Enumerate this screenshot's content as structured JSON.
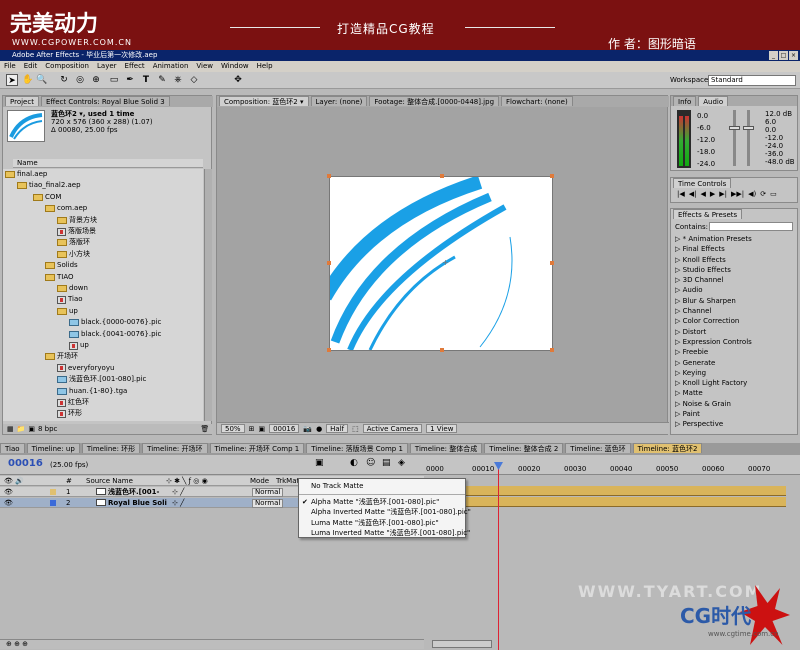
{
  "banner": {
    "logo": "完美动力",
    "url": "WWW.CGPOWER.COM.CN",
    "slogan": "打造精品CG教程",
    "author": "作 者：图形暗语"
  },
  "window": {
    "title": "Adobe After Effects - 毕业后第一次修改.aep"
  },
  "menu": [
    "File",
    "Edit",
    "Composition",
    "Layer",
    "Effect",
    "Animation",
    "View",
    "Window",
    "Help"
  ],
  "toolbar": {
    "workspace_label": "Workspace:",
    "workspace_value": "Standard"
  },
  "project": {
    "tabs": [
      "Project",
      "Effect Controls: Royal Blue Solid 3"
    ],
    "selected_name": "蓝色环2 ▾, used 1 time",
    "info_lines": [
      "720 x 576  (360 x 288) (1.07)",
      "Δ 00080, 25.00 fps"
    ],
    "column_name": "Name",
    "items": [
      {
        "label": "final.aep",
        "type": "folder"
      },
      {
        "label": "tiao_final2.aep",
        "type": "folder"
      },
      {
        "label": "COM",
        "type": "folder"
      },
      {
        "label": "com.aep",
        "type": "folder"
      },
      {
        "label": "背景方块",
        "type": "folder"
      },
      {
        "label": "落版场景",
        "type": "comp"
      },
      {
        "label": "落版环",
        "type": "folder"
      },
      {
        "label": "小方块",
        "type": "folder"
      },
      {
        "label": "Solids",
        "type": "folder"
      },
      {
        "label": "TIAO",
        "type": "folder"
      },
      {
        "label": "down",
        "type": "folder"
      },
      {
        "label": "Tiao",
        "type": "comp"
      },
      {
        "label": "up",
        "type": "folder"
      },
      {
        "label": "black.{0000-0076}.pic",
        "type": "image"
      },
      {
        "label": "black.{0041-0076}.pic",
        "type": "image"
      },
      {
        "label": "up",
        "type": "comp"
      },
      {
        "label": "开场环",
        "type": "folder"
      },
      {
        "label": "everyforyoyu",
        "type": "comp"
      },
      {
        "label": "浅蓝色环.[001-080].pic",
        "type": "image"
      },
      {
        "label": "huan.{1-80}.tga",
        "type": "image"
      },
      {
        "label": "红色环",
        "type": "comp"
      },
      {
        "label": "环形",
        "type": "comp"
      }
    ],
    "bpc": "8 bpc"
  },
  "comp": {
    "tabs": [
      "Composition: 蓝色环2 ▾",
      "Layer: (none)",
      "Footage: 整体合成.[0000-0448].jpg",
      "Flowchart: (none)"
    ],
    "zoom": "50%",
    "timecode": "00016",
    "resolution": "Half",
    "camera": "Active Camera",
    "view": "1 View"
  },
  "info_panel": {
    "tabs": [
      "Info",
      "Audio"
    ],
    "db_left": [
      "0.0",
      "-6.0",
      "-12.0",
      "-18.0",
      "-24.0"
    ],
    "db_right": [
      "12.0 dB",
      "6.0",
      "0.0",
      "-12.0",
      "-24.0",
      "-36.0",
      "-48.0 dB"
    ]
  },
  "time_controls": {
    "title": "Time Controls",
    "buttons": [
      "|◀",
      "◀|",
      "◀",
      "▶",
      "▶|",
      "▶▶|",
      "◀)",
      "⟳",
      "▭"
    ]
  },
  "effects": {
    "title": "Effects & Presets",
    "contains_label": "Contains:",
    "items": [
      "* Animation Presets",
      "Final Effects",
      "Knoll Effects",
      "Studio Effects",
      "3D Channel",
      "Audio",
      "Blur & Sharpen",
      "Channel",
      "Color Correction",
      "Distort",
      "Expression Controls",
      "Freebie",
      "Generate",
      "Keying",
      "Knoll Light Factory",
      "Matte",
      "Noise & Grain",
      "Paint",
      "Perspective"
    ]
  },
  "timeline": {
    "tabs": [
      "Tiao",
      "Timeline: up",
      "Timeline: 环形",
      "Timeline: 开场环",
      "Timeline: 开场环 Comp 1",
      "Timeline: 落版场景 Comp 1",
      "Timeline: 整体合成",
      "Timeline: 整体合成 2",
      "Timeline: 蓝色环",
      "Timeline: 蓝色环2"
    ],
    "timecode": "00016",
    "fps": "(25.00 fps)",
    "col_num": "#",
    "col_source": "Source Name",
    "col_trkmat": "TrkMat",
    "layers": [
      {
        "num": "1",
        "name": "浅蓝色环.[001-",
        "mode": "Normal"
      },
      {
        "num": "2",
        "name": "Royal Blue Soli",
        "mode": "Normal"
      }
    ],
    "ruler": [
      "0000",
      "00010",
      "00020",
      "00030",
      "00040",
      "00050",
      "00060",
      "00070"
    ]
  },
  "dropdown": {
    "items": [
      {
        "label": "No Track Matte",
        "checked": false
      },
      {
        "label": "Alpha Matte \"浅蓝色环.[001-080].pic\"",
        "checked": true
      },
      {
        "label": "Alpha Inverted Matte \"浅蓝色环.[001-080].pic\"",
        "checked": false
      },
      {
        "label": "Luma Matte \"浅蓝色环.[001-080].pic\"",
        "checked": false
      },
      {
        "label": "Luma Inverted Matte \"浅蓝色环.[001-080].pic\"",
        "checked": false
      }
    ]
  },
  "watermark": {
    "text": "WWW.TYART.COM",
    "cg": "CG时代",
    "cg_url": "www.cgtime.com.cn"
  },
  "colors": {
    "banner": "#7b1111",
    "accent_blue": "#1a9be0",
    "playhead": "#d23"
  }
}
